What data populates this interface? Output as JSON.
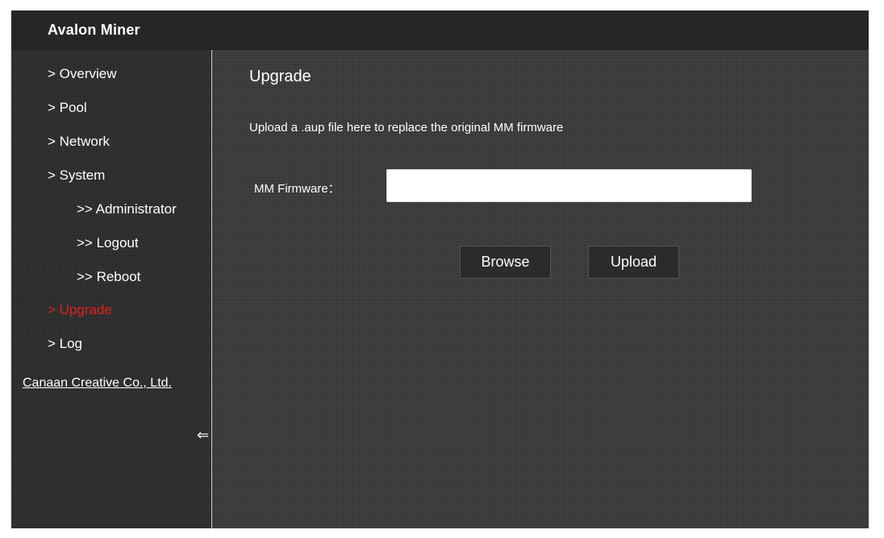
{
  "app": {
    "title": "Avalon Miner"
  },
  "sidebar": {
    "items": [
      {
        "label": "> Overview"
      },
      {
        "label": "> Pool"
      },
      {
        "label": "> Network"
      },
      {
        "label": "> System"
      },
      {
        "label": ">> Administrator"
      },
      {
        "label": ">> Logout"
      },
      {
        "label": ">> Reboot"
      },
      {
        "label": "> Upgrade",
        "active": true
      },
      {
        "label": "> Log"
      }
    ],
    "company_link": "Canaan Creative Co., Ltd.",
    "collapse_icon": "⇐",
    "active_color": "#e02020"
  },
  "main": {
    "title": "Upgrade",
    "description": "Upload a .aup file here to replace the original MM firmware",
    "firmware_label": "MM Firmware：",
    "firmware_value": "",
    "browse_label": "Browse",
    "upload_label": "Upload"
  }
}
